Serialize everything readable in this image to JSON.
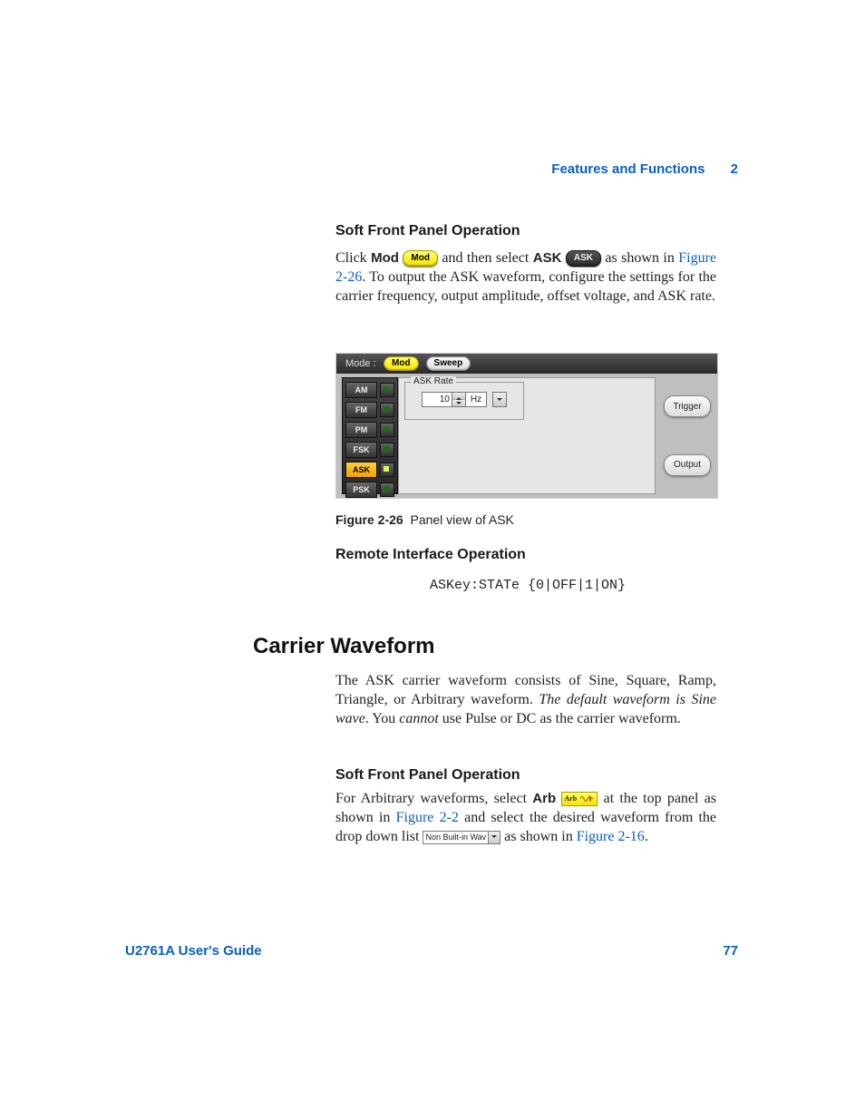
{
  "header": {
    "section": "Features and Functions",
    "chapter": "2"
  },
  "footer": {
    "guide": "U2761A User's Guide",
    "page": "77"
  },
  "section1": {
    "title": "Soft Front Panel Operation",
    "p_click": "Click",
    "p_mod": "Mod",
    "modpill": "Mod",
    "p_mid": "and then select",
    "p_ask": "ASK",
    "askpill": "ASK",
    "p_tail": "as shown in",
    "figref": "Figure 2-26",
    "p_after": ". To output the ASK waveform, configure the settings for the carrier frequency, output amplitude, offset voltage, and ASK rate."
  },
  "panel": {
    "modeLabel": "Mode :",
    "tabs": {
      "mod": "Mod",
      "sweep": "Sweep"
    },
    "side": [
      "AM",
      "FM",
      "PM",
      "FSK",
      "ASK",
      "PSK"
    ],
    "selected": "ASK",
    "group": "ASK Rate",
    "value": "10",
    "unit": "Hz",
    "trigger": "Trigger",
    "output": "Output"
  },
  "figure": {
    "num": "Figure 2-26",
    "caption": "Panel view of ASK"
  },
  "remote": {
    "title": "Remote Interface Operation",
    "code": "ASKey:STATe {0|OFF|1|ON}"
  },
  "carrier": {
    "heading": "Carrier Waveform",
    "p_a": "The ASK carrier waveform consists of Sine, Square, Ramp, Triangle, or Arbitrary waveform. ",
    "p_italic": "The default waveform is Sine wave",
    "p_b": ". You ",
    "p_cannot": "cannot",
    "p_c": " use Pulse or DC as the carrier waveform."
  },
  "sfpo2": {
    "title": "Soft Front Panel Operation"
  },
  "arbpara": {
    "a": "For Arbitrary waveforms, select ",
    "arb": "Arb",
    "arbIcon": "Arb",
    "b": " at the top panel as shown in ",
    "fig22": "Figure 2-2",
    "c": " and select the desired waveform from the drop down list ",
    "dd": "Non Built-in Wav",
    "d": " as shown in ",
    "fig216": "Figure 2-16",
    "e": "."
  }
}
